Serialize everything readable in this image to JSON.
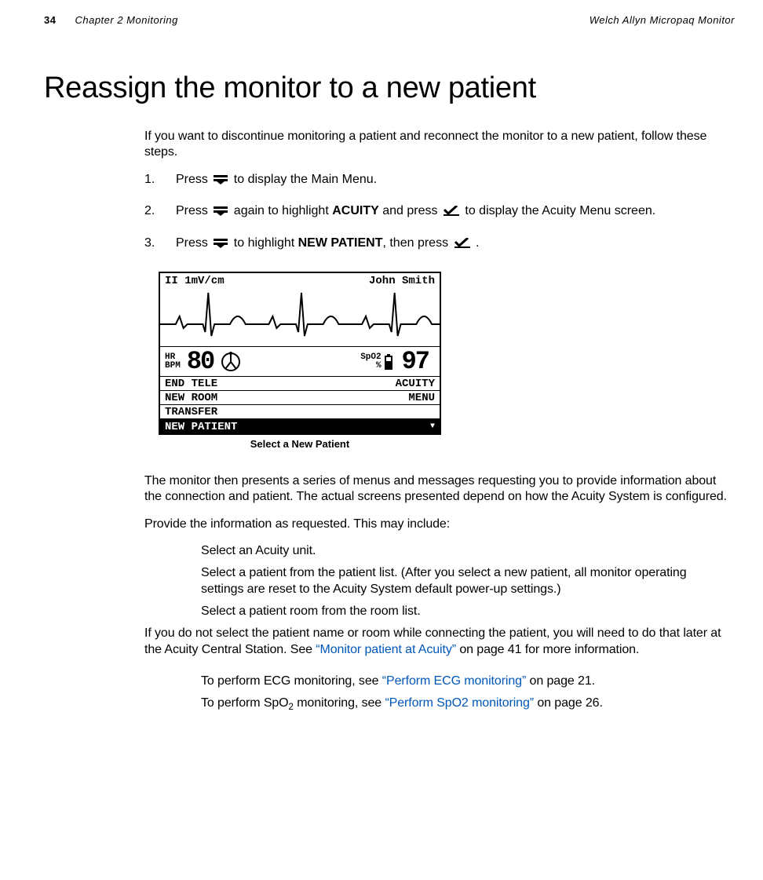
{
  "header": {
    "page_number": "34",
    "chapter_label": "Chapter 2   Monitoring",
    "product": "Welch Allyn Micropaq Monitor"
  },
  "h1": "Reassign the monitor to a new patient",
  "intro": "If you want to discontinue monitoring a patient and reconnect the monitor to a new patient, follow these steps.",
  "steps": {
    "s1a": "Press ",
    "s1b": " to display the Main Menu.",
    "s2a": "Press ",
    "s2b": " again to highlight ",
    "s2_bold": "ACUITY",
    "s2c": " and press  ",
    "s2d": "  to display the Acuity Menu screen.",
    "s3a": "Press ",
    "s3b": " to highlight ",
    "s3_bold": "NEW PATIENT",
    "s3c": ", then press  ",
    "s3d": " ."
  },
  "device": {
    "top_left": "II 1mV/cm",
    "top_right": "John Smith",
    "hr_label_1": "HR",
    "hr_label_2": "BPM",
    "hr_value": "80",
    "spo2_label_1": "SpO2",
    "spo2_label_2": "%",
    "spo2_value": "97",
    "menu": {
      "right_1": "ACUITY",
      "right_2": "MENU",
      "r1": "END TELE",
      "r2": "NEW ROOM",
      "r3": "TRANSFER",
      "r4": "NEW PATIENT"
    },
    "caption": "Select a New Patient"
  },
  "para_after_fig": "The monitor then presents a series of menus and messages requesting you to provide information about the connection and patient. The actual screens presented depend on how the Acuity System is configured.",
  "para_provide": "Provide the information as requested. This may include:",
  "bullets": {
    "b1": "Select an Acuity unit.",
    "b2": "Select a patient from the patient list. (After you select a new patient, all monitor operating settings are reset to the Acuity System default power-up settings.)",
    "b3": "Select a patient room from the room list."
  },
  "para_if_not_a": "If you do not select the patient name or room while connecting the patient, you will need to do that later at the Acuity Central Station. See ",
  "link1": "“Monitor patient at Acuity”",
  "para_if_not_b": " on page 41 for more information.",
  "tail": {
    "t1a": "To perform ECG monitoring, see ",
    "t1_link": "“Perform ECG monitoring”",
    "t1b": " on page 21.",
    "t2a": "To perform SpO",
    "t2_sub": "2",
    "t2b": " monitoring, see ",
    "t2_link": "“Perform SpO2 monitoring”",
    "t2c": " on page 26."
  }
}
